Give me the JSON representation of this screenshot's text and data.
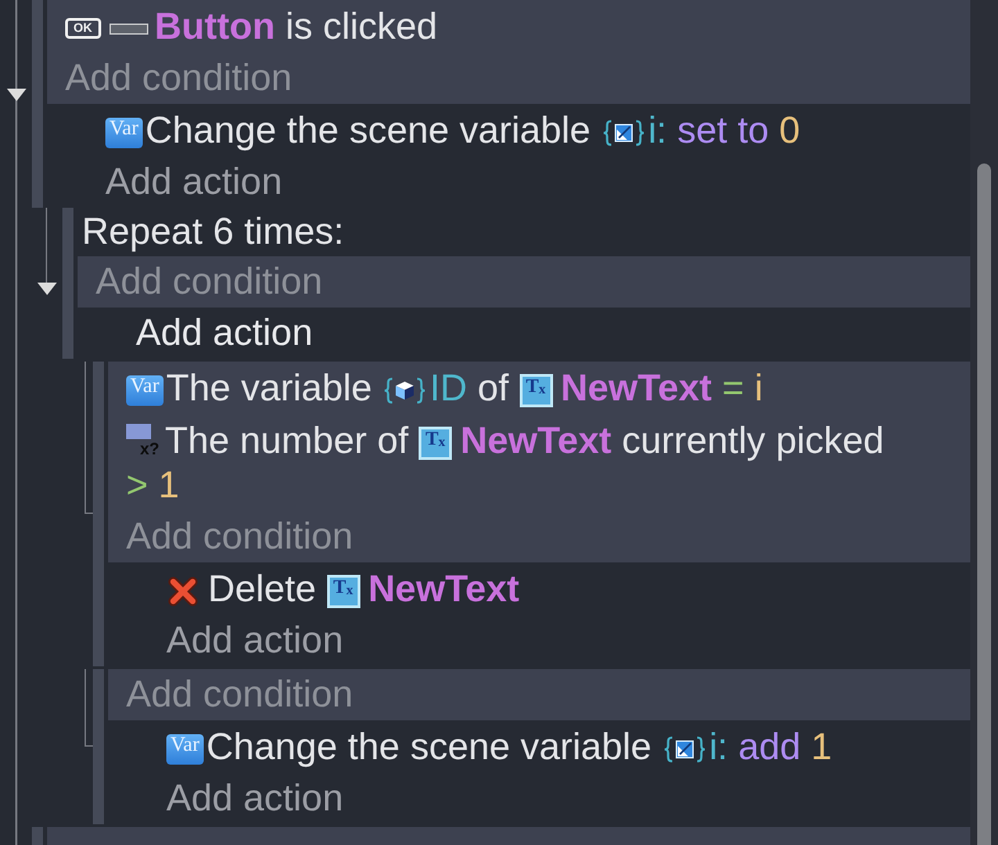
{
  "events": [
    {
      "kind": "standard",
      "expanded": true,
      "conditions": [
        {
          "parts": [
            {
              "kind": "ok_tag",
              "text": "OK"
            },
            {
              "kind": "button_icon"
            },
            {
              "kind": "object",
              "text": "Button"
            },
            {
              "kind": "text",
              "text": "is clicked"
            }
          ]
        }
      ],
      "add_condition": "Add condition",
      "actions": [
        {
          "parts": [
            {
              "kind": "var_tag",
              "text": "Var"
            },
            {
              "kind": "text",
              "text": "Change the scene variable"
            },
            {
              "kind": "scenevar_icon"
            },
            {
              "kind": "variable",
              "text": "i:"
            },
            {
              "kind": "keyword",
              "text": "set to"
            },
            {
              "kind": "value",
              "text": "0"
            }
          ]
        }
      ],
      "add_action": {
        "label": "Add action",
        "hovered": false
      },
      "children": [
        {
          "kind": "repeat",
          "expanded": true,
          "header": "Repeat 6 times:",
          "add_condition": "Add condition",
          "add_action": {
            "label": "Add action",
            "hovered": true
          },
          "children": [
            {
              "kind": "standard",
              "conditions": [
                {
                  "parts": [
                    {
                      "kind": "var_tag",
                      "text": "Var"
                    },
                    {
                      "kind": "text",
                      "text": "The variable"
                    },
                    {
                      "kind": "objvar_icon"
                    },
                    {
                      "kind": "variable",
                      "text": "ID"
                    },
                    {
                      "kind": "text",
                      "text": "of"
                    },
                    {
                      "kind": "tx_tag",
                      "text": "T$_{x}$"
                    },
                    {
                      "kind": "object",
                      "text": "NewText"
                    },
                    {
                      "kind": "operator",
                      "text": "="
                    },
                    {
                      "kind": "value",
                      "text": "i"
                    }
                  ]
                },
                {
                  "parts": [
                    {
                      "kind": "count_tag",
                      "text": "x?"
                    },
                    {
                      "kind": "text",
                      "text": "The number of"
                    },
                    {
                      "kind": "tx_tag",
                      "text": "T$_{x}$"
                    },
                    {
                      "kind": "object",
                      "text": "NewText"
                    },
                    {
                      "kind": "text",
                      "text": "currently picked"
                    },
                    {
                      "kind": "operator",
                      "text": ">"
                    },
                    {
                      "kind": "value",
                      "text": "1"
                    }
                  ]
                }
              ],
              "add_condition": "Add condition",
              "actions": [
                {
                  "parts": [
                    {
                      "kind": "delete_icon"
                    },
                    {
                      "kind": "text",
                      "text": "Delete"
                    },
                    {
                      "kind": "tx_tag",
                      "text": "T$_{x}$"
                    },
                    {
                      "kind": "object",
                      "text": "NewText"
                    }
                  ]
                }
              ],
              "add_action": {
                "label": "Add action",
                "hovered": false
              }
            },
            {
              "kind": "standard",
              "add_condition": "Add condition",
              "actions": [
                {
                  "parts": [
                    {
                      "kind": "var_tag",
                      "text": "Var"
                    },
                    {
                      "kind": "text",
                      "text": "Change the scene variable"
                    },
                    {
                      "kind": "scenevar_icon"
                    },
                    {
                      "kind": "variable",
                      "text": "i:"
                    },
                    {
                      "kind": "keyword",
                      "text": "add"
                    },
                    {
                      "kind": "value",
                      "text": "1"
                    }
                  ]
                }
              ],
              "add_action": {
                "label": "Add action",
                "hovered": false
              }
            }
          ]
        }
      ]
    },
    {
      "kind": "standard"
    }
  ]
}
